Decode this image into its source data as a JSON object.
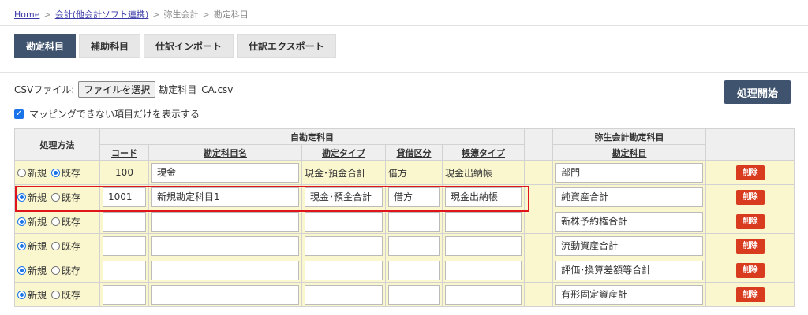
{
  "breadcrumb": {
    "home": "Home",
    "accounting": "会計(他会計ソフト連携)",
    "yayoi": "弥生会計",
    "current": "勘定科目"
  },
  "tabs": [
    "勘定科目",
    "補助科目",
    "仕訳インポート",
    "仕訳エクスポート"
  ],
  "file": {
    "label": "CSVファイル:",
    "button": "ファイルを選択",
    "filename": "勘定科目_CA.csv"
  },
  "start_button": "処理開始",
  "mapping_filter": {
    "label": "マッピングできない項目だけを表示する",
    "checked": true
  },
  "table": {
    "group_own": "自勘定科目",
    "group_yayoi": "弥生会計勘定科目",
    "col_method": "処理方法",
    "cols": [
      "コード",
      "勘定科目名",
      "勘定タイプ",
      "貸借区分",
      "帳簿タイプ"
    ],
    "col_yayoi": "勘定科目",
    "radio_new": "新規",
    "radio_existing": "既存",
    "delete_label": "削除",
    "rows": [
      {
        "mode": "existing",
        "code": "100",
        "name": "現金",
        "type": "現金･預金合計",
        "side": "借方",
        "book": "現金出納帳",
        "yayoi": "部門"
      },
      {
        "mode": "new",
        "code": "1001",
        "name": "新規勘定科目1",
        "type": "現金･預金合計",
        "side": "借方",
        "book": "現金出納帳",
        "yayoi": "純資産合計"
      },
      {
        "mode": "new",
        "code": "",
        "name": "",
        "type": "",
        "side": "",
        "book": "",
        "yayoi": "新株予約権合計"
      },
      {
        "mode": "new",
        "code": "",
        "name": "",
        "type": "",
        "side": "",
        "book": "",
        "yayoi": "流動資産合計"
      },
      {
        "mode": "new",
        "code": "",
        "name": "",
        "type": "",
        "side": "",
        "book": "",
        "yayoi": "評価･換算差額等合計"
      },
      {
        "mode": "new",
        "code": "",
        "name": "",
        "type": "",
        "side": "",
        "book": "",
        "yayoi": "有形固定資産計"
      }
    ]
  },
  "colors": {
    "accent": "#3f536e",
    "row_bg": "#faf7cf",
    "delete": "#d93b1f",
    "highlight": "#e0151b"
  }
}
